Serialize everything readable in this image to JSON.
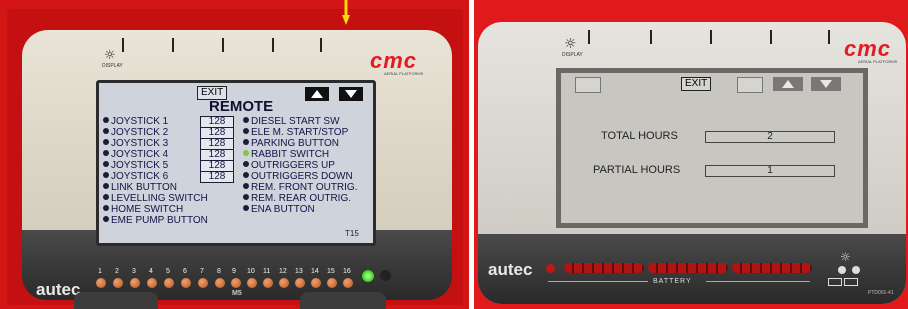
{
  "left": {
    "brand": "cmc",
    "brand_sub": "AERIAL PLATFORMS",
    "display_label": "DISPLAY",
    "screen": {
      "exit_label": "EXIT",
      "title": "REMOTE",
      "joysticks": [
        {
          "label": "JOYSTICK 1",
          "value": "128"
        },
        {
          "label": "JOYSTICK 2",
          "value": "128"
        },
        {
          "label": "JOYSTICK 3",
          "value": "128"
        },
        {
          "label": "JOYSTICK 4",
          "value": "128"
        },
        {
          "label": "JOYSTICK 5",
          "value": "128"
        },
        {
          "label": "JOYSTICK 6",
          "value": "128"
        }
      ],
      "left_items": [
        "LINK BUTTON",
        "LEVELLING SWITCH",
        "HOME SWITCH",
        "EME PUMP BUTTON"
      ],
      "right_items": [
        {
          "label": "DIESEL START SW",
          "active": false
        },
        {
          "label": "ELE M. START/STOP",
          "active": false
        },
        {
          "label": "PARKING BUTTON",
          "active": false
        },
        {
          "label": "RABBIT SWITCH",
          "active": true
        },
        {
          "label": "OUTRIGGERS UP",
          "active": false
        },
        {
          "label": "OUTRIGGERS DOWN",
          "active": false
        },
        {
          "label": "REM. FRONT OUTRIG.",
          "active": false
        },
        {
          "label": "REM. REAR OUTRIG.",
          "active": false
        },
        {
          "label": "ENA BUTTON",
          "active": false
        }
      ],
      "page_code": "T15"
    },
    "led_numbers": [
      "1",
      "2",
      "3",
      "4",
      "5",
      "6",
      "7",
      "8",
      "9",
      "10",
      "11",
      "12",
      "13",
      "14",
      "15",
      "16"
    ],
    "bottom_brand": "autec",
    "bottom_label": "M5",
    "arrow_color": "#f5d90a"
  },
  "right": {
    "brand": "cmc",
    "brand_sub": "AERIAL PLATFORMS",
    "display_label": "DISPLAY",
    "screen": {
      "exit_label": "EXIT",
      "rows": [
        {
          "label": "TOTAL HOURS",
          "value": "2"
        },
        {
          "label": "PARTIAL HOURS",
          "value": "1"
        }
      ]
    },
    "bottom_brand": "autec",
    "battery_label": "BATTERY",
    "model_code": "PTD001-41"
  },
  "colors": {
    "accent_red": "#e31b23",
    "frame_red": "#d41515",
    "led_green": "#3ddc1f"
  }
}
